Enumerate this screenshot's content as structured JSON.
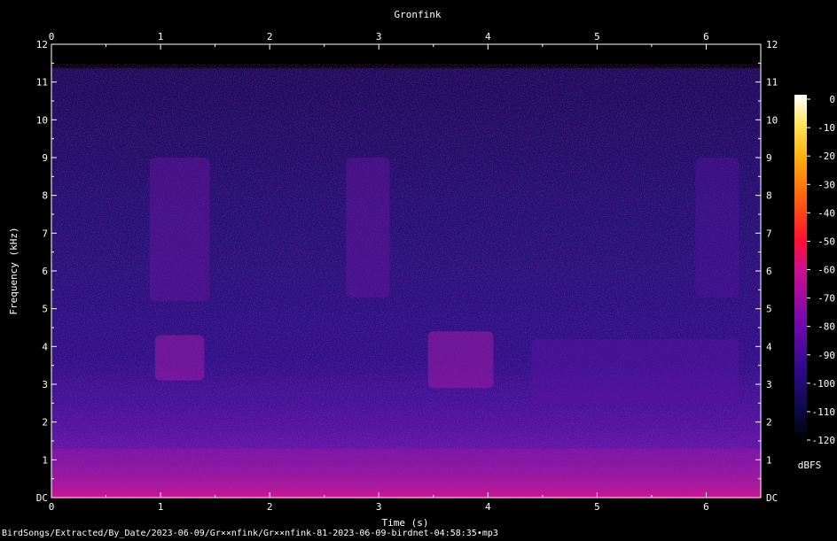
{
  "chart_data": {
    "type": "heatmap",
    "title": "Gronfink",
    "xlabel": "Time (s)",
    "ylabel": "Frequency (kHz)",
    "xlim": [
      0,
      6.5
    ],
    "ylim": [
      0,
      12
    ],
    "x_ticks": [
      "0",
      "1",
      "2",
      "3",
      "4",
      "5",
      "6"
    ],
    "y_ticks": [
      "DC",
      "1",
      "2",
      "3",
      "4",
      "5",
      "6",
      "7",
      "8",
      "9",
      "10",
      "11",
      "12"
    ],
    "colorbar": {
      "label": "dBFS",
      "range": [
        -120,
        0
      ],
      "ticks": [
        "0",
        "-10",
        "-20",
        "-30",
        "-40",
        "-50",
        "-60",
        "-70",
        "-80",
        "-90",
        "-100",
        "-110",
        "-120"
      ]
    },
    "notes": "Spectrogram: broadband low-frequency energy; song phrases near 1.0-1.4 s, 2.8-3.1 s, 3.5-4.0 s, 4.3-6.5 s"
  },
  "colors": {
    "background": "#000000",
    "text": "#ffffff",
    "axes": "#ffffff"
  },
  "footer": {
    "path": "BirdSongs/Extracted/By_Date/2023-06-09/Gr××nfink/Gr××nfink-81-2023-06-09-birdnet-04:58:35•mp3"
  }
}
